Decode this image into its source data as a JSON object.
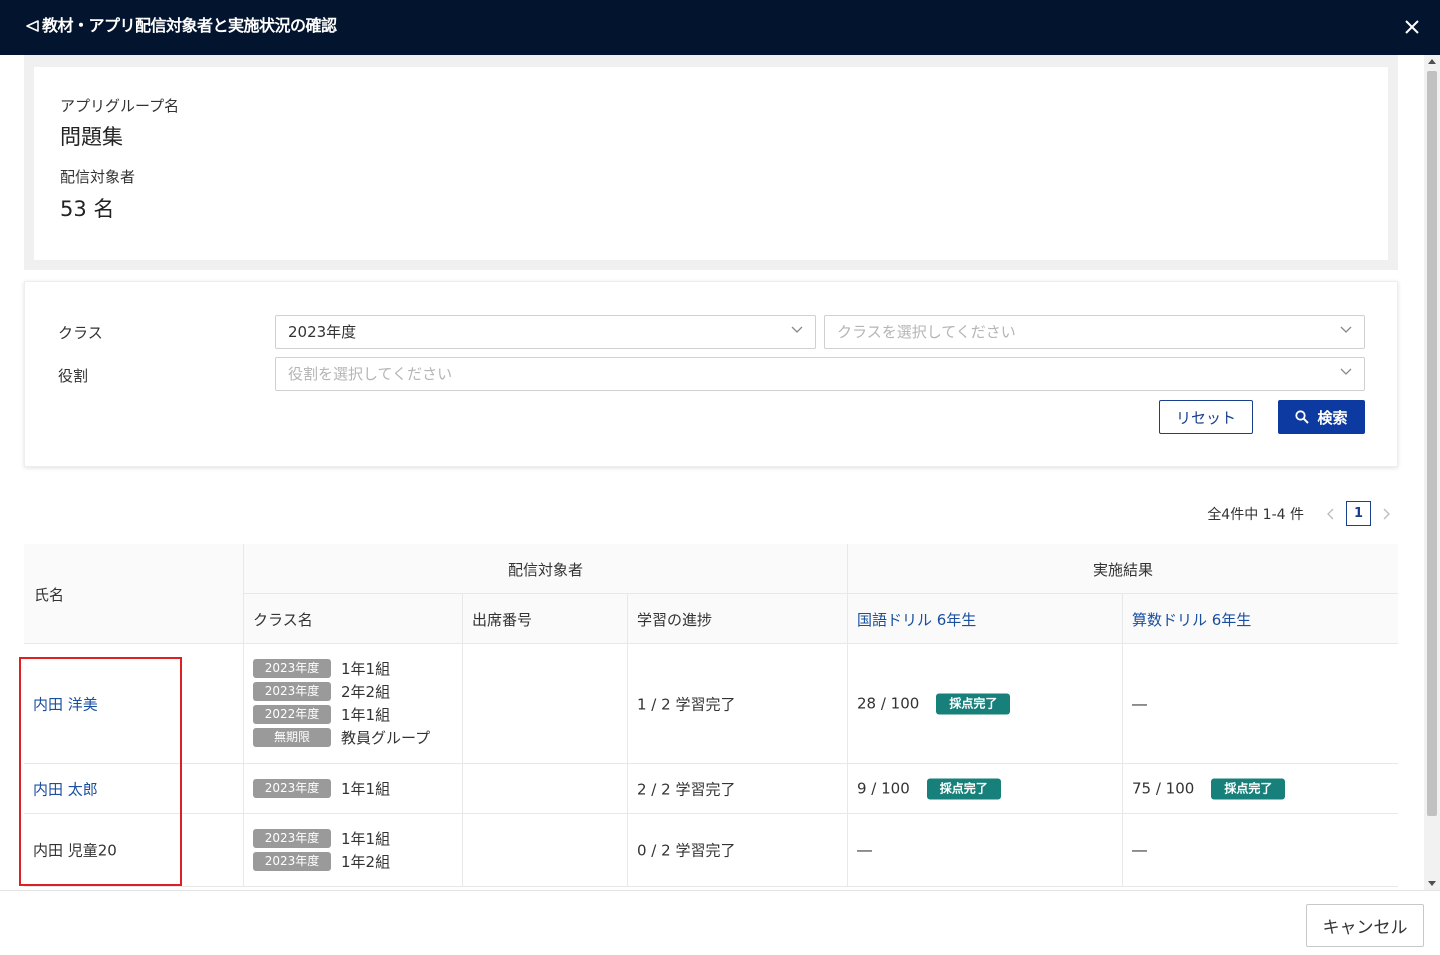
{
  "header": {
    "title": "教材・アプリ配信対象者と実施状況の確認",
    "back_icon": "back-arrow-icon",
    "close_icon": "close-icon"
  },
  "info": {
    "group_label": "アプリグループ名",
    "group_value": "問題集",
    "target_label": "配信対象者",
    "target_value": "53 名"
  },
  "filter": {
    "class_label": "クラス",
    "class_year_value": "2023年度",
    "class_placeholder": "クラスを選択してください",
    "role_label": "役割",
    "role_placeholder": "役割を選択してください",
    "reset_label": "リセット",
    "search_label": "検索",
    "search_color": "#0d3aa0"
  },
  "pagination": {
    "summary": "全4件中 1-4 件",
    "current_page": "1"
  },
  "table": {
    "headers": {
      "name": "氏名",
      "delivery_group": "配信対象者",
      "results_group": "実施結果",
      "class_name": "クラス名",
      "seat_number": "出席番号",
      "progress": "学習の進捗",
      "drill_jp": "国語ドリル 6年生",
      "drill_math": "算数ドリル 6年生"
    },
    "rows": [
      {
        "name": "内田 洋美",
        "name_is_link": true,
        "classes": [
          {
            "year": "2023年度",
            "name": "1年1組"
          },
          {
            "year": "2023年度",
            "name": "2年2組"
          },
          {
            "year": "2022年度",
            "name": "1年1組"
          },
          {
            "year": "無期限",
            "name": "教員グループ"
          }
        ],
        "seat": "",
        "progress": "1 / 2 学習完了",
        "jp_score": "28 / 100",
        "jp_badge": "採点完了",
        "math_score": "―",
        "math_badge": ""
      },
      {
        "name": "内田 太郎",
        "name_is_link": true,
        "classes": [
          {
            "year": "2023年度",
            "name": "1年1組"
          }
        ],
        "seat": "",
        "progress": "2 / 2 学習完了",
        "jp_score": "9 / 100",
        "jp_badge": "採点完了",
        "math_score": "75 / 100",
        "math_badge": "採点完了"
      },
      {
        "name": "内田 児童20",
        "name_is_link": false,
        "classes": [
          {
            "year": "2023年度",
            "name": "1年1組"
          },
          {
            "year": "2023年度",
            "name": "1年2組"
          }
        ],
        "seat": "",
        "progress": "0 / 2 学習完了",
        "jp_score": "―",
        "jp_badge": "",
        "math_score": "―",
        "math_badge": ""
      }
    ]
  },
  "footer": {
    "cancel_label": "キャンセル"
  },
  "colors": {
    "header_bg": "#03142e",
    "link": "#1a4fa0",
    "badge_bg": "#18807a",
    "chip_bg": "#9a9a9a",
    "highlight_border": "#e02020"
  }
}
